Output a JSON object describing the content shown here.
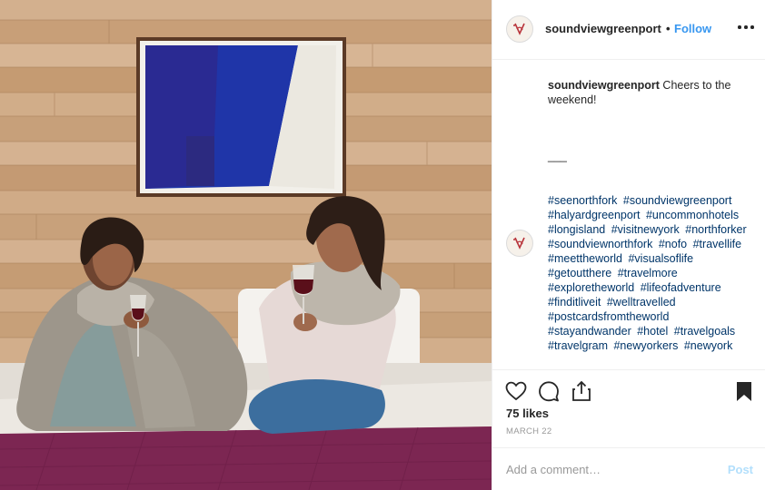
{
  "post": {
    "image_description_icon": "photo",
    "username": "soundviewgreenport",
    "separator": "•",
    "follow_label": "Follow",
    "more_icon": "more-horizontal-icon",
    "caption_username": "soundviewgreenport",
    "caption_text": " Cheers to the weekend!",
    "dash": "___",
    "comment_username": "soundviewgreenport",
    "hashtags": [
      "#seenorthfork",
      "#soundviewgreenport",
      "#halyardgreenport",
      "#uncommonhotels",
      "#longisland",
      "#visitnewyork",
      "#northforker",
      "#soundviewnorthfork",
      "#nofo",
      "#travellife",
      "#meettheworld",
      "#visualsoflife",
      "#getoutthere",
      "#travelmore",
      "#exploretheworld",
      "#lifeofadventure",
      "#finditliveit",
      "#welltravelled",
      "#postcardsfromtheworld",
      "#stayandwander",
      "#hotel",
      "#travelgoals",
      "#travelgram",
      "#newyorkers",
      "#newyork"
    ],
    "likes": "75 likes",
    "date": "MARCH 22",
    "comment_placeholder": "Add a comment…",
    "post_label": "Post"
  },
  "colors": {
    "link": "#3897f0",
    "hashtag": "#003569",
    "post_disabled": "#b2dffc"
  }
}
